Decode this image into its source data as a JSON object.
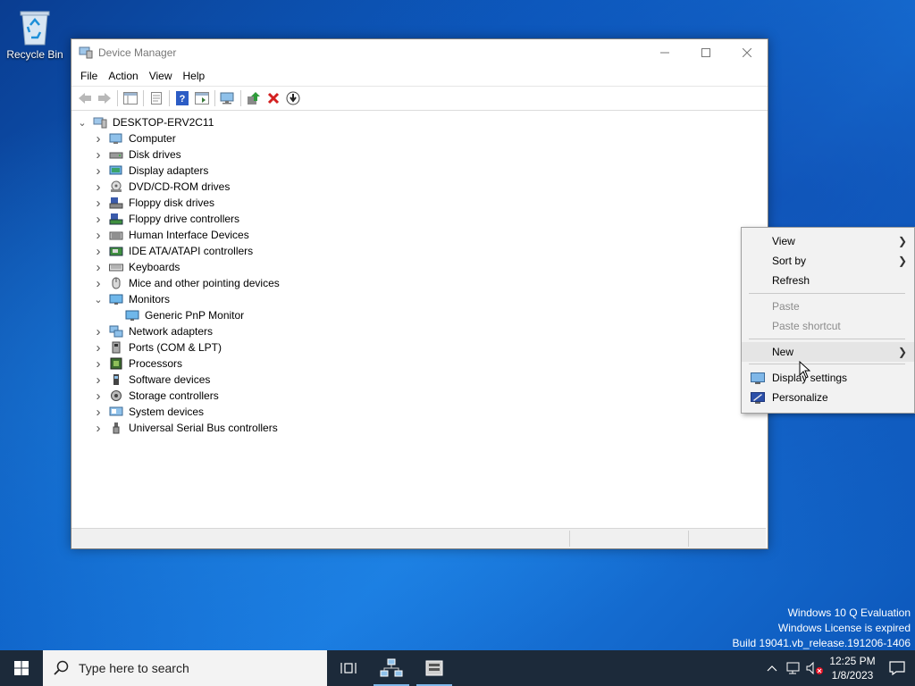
{
  "desktop": {
    "recycle_bin_label": "Recycle Bin",
    "watermark": [
      "Windows 10 Q Evaluation",
      "Windows License is expired",
      "Build 19041.vb_release.191206-1406"
    ]
  },
  "window": {
    "title": "Device Manager",
    "menu": [
      "File",
      "Action",
      "View",
      "Help"
    ],
    "root": "DESKTOP-ERV2C11",
    "tree": [
      {
        "label": "Computer",
        "icon": "computer-icon",
        "state": "collapsed"
      },
      {
        "label": "Disk drives",
        "icon": "disk-drive-icon",
        "state": "collapsed"
      },
      {
        "label": "Display adapters",
        "icon": "display-adapter-icon",
        "state": "collapsed"
      },
      {
        "label": "DVD/CD-ROM drives",
        "icon": "dvd-drive-icon",
        "state": "collapsed"
      },
      {
        "label": "Floppy disk drives",
        "icon": "floppy-drive-icon",
        "state": "collapsed"
      },
      {
        "label": "Floppy drive controllers",
        "icon": "floppy-controller-icon",
        "state": "collapsed"
      },
      {
        "label": "Human Interface Devices",
        "icon": "hid-icon",
        "state": "collapsed"
      },
      {
        "label": "IDE ATA/ATAPI controllers",
        "icon": "ide-controller-icon",
        "state": "collapsed"
      },
      {
        "label": "Keyboards",
        "icon": "keyboard-icon",
        "state": "collapsed"
      },
      {
        "label": "Mice and other pointing devices",
        "icon": "mouse-icon",
        "state": "collapsed"
      },
      {
        "label": "Monitors",
        "icon": "monitor-icon",
        "state": "expanded"
      },
      {
        "label": "Generic PnP Monitor",
        "icon": "monitor-icon",
        "state": "child"
      },
      {
        "label": "Network adapters",
        "icon": "network-adapter-icon",
        "state": "collapsed"
      },
      {
        "label": "Ports (COM & LPT)",
        "icon": "port-icon",
        "state": "collapsed"
      },
      {
        "label": "Processors",
        "icon": "processor-icon",
        "state": "collapsed"
      },
      {
        "label": "Software devices",
        "icon": "software-device-icon",
        "state": "collapsed"
      },
      {
        "label": "Storage controllers",
        "icon": "storage-controller-icon",
        "state": "collapsed"
      },
      {
        "label": "System devices",
        "icon": "system-device-icon",
        "state": "collapsed"
      },
      {
        "label": "Universal Serial Bus controllers",
        "icon": "usb-icon",
        "state": "collapsed"
      }
    ]
  },
  "context_menu": {
    "view": "View",
    "sort_by": "Sort by",
    "refresh": "Refresh",
    "paste": "Paste",
    "paste_shortcut": "Paste shortcut",
    "new": "New",
    "display_settings": "Display settings",
    "personalize": "Personalize"
  },
  "taskbar": {
    "search_placeholder": "Type here to search",
    "time": "12:25 PM",
    "date": "1/8/2023"
  },
  "colors": {
    "taskbar": "#1c2a3a",
    "accent": "#0078d7",
    "desktop": "#0e61c6"
  }
}
